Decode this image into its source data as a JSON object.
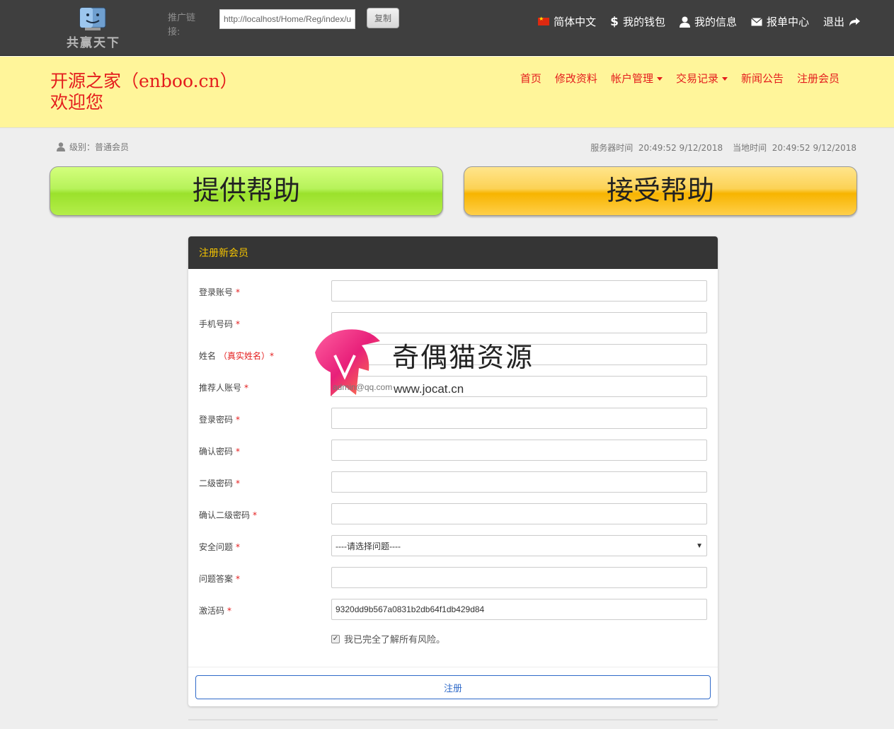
{
  "topbar": {
    "logo_text": "共赢天下",
    "promo_label": "推广链接:",
    "promo_link": "http://localhost/Home/Reg/index/u",
    "copy_label": "复制",
    "nav": [
      {
        "label": "简体中文",
        "icon": "china-flag-icon"
      },
      {
        "label": "我的钱包",
        "icon": "dollar-icon"
      },
      {
        "label": "我的信息",
        "icon": "user-icon"
      },
      {
        "label": "报单中心",
        "icon": "envelope-icon"
      },
      {
        "label": "退出",
        "icon": "share-arrow-icon"
      }
    ]
  },
  "header": {
    "title_line1": "开源之家（enboo.cn）",
    "title_line2": "欢迎您",
    "nav": [
      "首页",
      "修改资料",
      "帐户管理",
      "交易记录",
      "新闻公告",
      "注册会员"
    ]
  },
  "info": {
    "level": "级别：普通会员",
    "server_time_label": "服务器时间",
    "server_time": "20:49:52 9/12/2018",
    "local_time_label": "当地时间",
    "local_time": "20:49:52 9/12/2018"
  },
  "actions": {
    "offer_help": "提供帮助",
    "receive_help": "接受帮助"
  },
  "form": {
    "title": "注册新会员",
    "fields": [
      {
        "label": "登录账号",
        "value": ""
      },
      {
        "label": "手机号码",
        "value": ""
      },
      {
        "label": "姓名",
        "sub": "（真实姓名）",
        "value": ""
      },
      {
        "label": "推荐人账号",
        "value": ""
      },
      {
        "label": "登录密码",
        "value": ""
      },
      {
        "label": "确认密码",
        "value": ""
      },
      {
        "label": "二级密码",
        "value": ""
      },
      {
        "label": "确认二级密码",
        "value": ""
      },
      {
        "label": "安全问题",
        "value": "----请选择问题----"
      },
      {
        "label": "问题答案",
        "value": ""
      },
      {
        "label": "激活码",
        "value": "9320dd9b567a0831b2db64f1db429d84"
      }
    ],
    "required_mark": "*",
    "agree_text": "我已完全了解所有风险。",
    "submit_label": "注册"
  },
  "watermark": {
    "text": "奇偶猫资源",
    "url": "www.jocat.cn",
    "overlay": "admin@qq.com"
  },
  "colors": {
    "topbar": "#3f3f3f",
    "header": "#fff59a",
    "accent_red": "#e41d1d",
    "offer_green": "#9be12c",
    "receive_orange": "#f7b400",
    "panel_head": "#353535",
    "panel_title": "#f5c400"
  }
}
